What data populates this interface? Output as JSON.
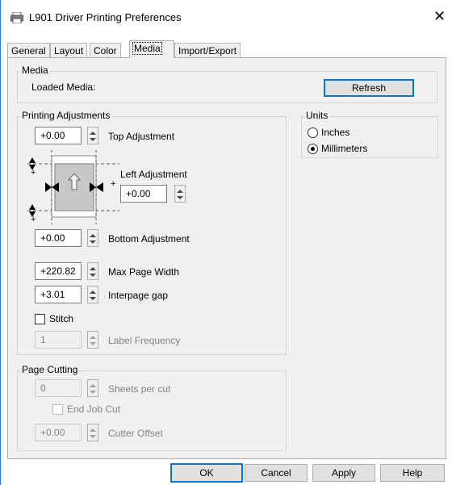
{
  "window": {
    "title": "L901 Driver Printing Preferences",
    "close_glyph": "✕",
    "printer_icon": "printer-icon"
  },
  "tabs": [
    {
      "label": "General",
      "active": false
    },
    {
      "label": "Layout",
      "active": false
    },
    {
      "label": "Color",
      "active": false
    },
    {
      "label": "Media",
      "active": true
    },
    {
      "label": "Import/Export",
      "active": false
    }
  ],
  "media": {
    "group_label": "Media",
    "loaded_label": "Loaded Media:",
    "loaded_value": "",
    "refresh_label": "Refresh"
  },
  "adjust": {
    "group_label": "Printing Adjustments",
    "top_value": "+0.00",
    "top_label": "Top Adjustment",
    "left_label": "Left Adjustment",
    "left_value": "+0.00",
    "bottom_value": "+0.00",
    "bottom_label": "Bottom Adjustment",
    "maxwidth_value": "+220.82",
    "maxwidth_label": "Max Page Width",
    "gap_value": "+3.01",
    "gap_label": "Interpage gap",
    "stitch_label": "Stitch",
    "stitch_checked": false,
    "freq_value": "1",
    "freq_label": "Label Frequency",
    "plus": "+"
  },
  "units": {
    "group_label": "Units",
    "options": [
      {
        "label": "Inches",
        "selected": false
      },
      {
        "label": "Millimeters",
        "selected": true
      }
    ]
  },
  "cutting": {
    "group_label": "Page Cutting",
    "sheets_value": "0",
    "sheets_label": "Sheets per cut",
    "endjob_label": "End Job Cut",
    "endjob_checked": false,
    "offset_value": "+0.00",
    "offset_label": "Cutter Offset"
  },
  "footer": {
    "ok": "OK",
    "cancel": "Cancel",
    "apply": "Apply",
    "help": "Help"
  },
  "colors": {
    "accent": "#0078d7",
    "panel": "#f0f0f0",
    "disabled_text": "#838383"
  }
}
